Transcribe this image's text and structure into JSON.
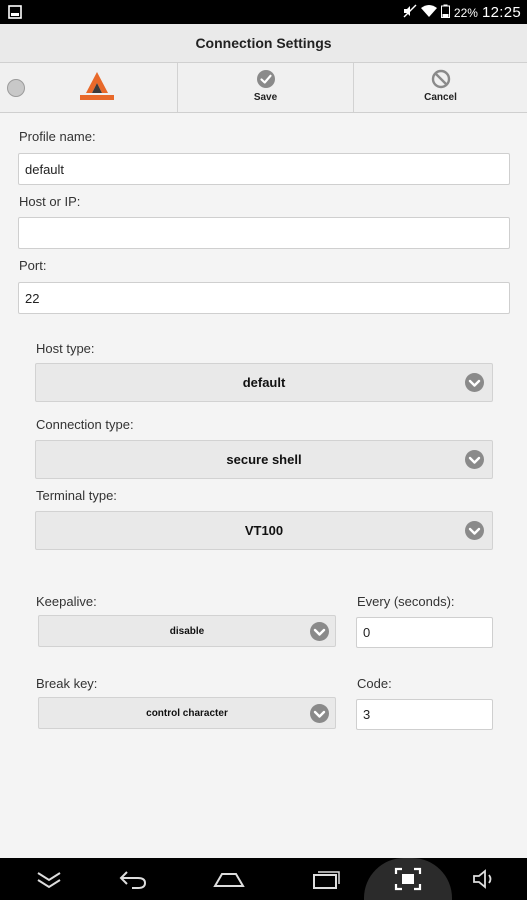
{
  "status_bar": {
    "battery": "22%",
    "time": "12:25"
  },
  "title": "Connection Settings",
  "toolbar": {
    "save_label": "Save",
    "cancel_label": "Cancel"
  },
  "form": {
    "profile_name": {
      "label": "Profile name:",
      "value": "default"
    },
    "host": {
      "label": "Host or IP:",
      "value": ""
    },
    "port": {
      "label": "Port:",
      "value": "22"
    },
    "host_type": {
      "label": "Host type:",
      "value": "default"
    },
    "connection_type": {
      "label": "Connection type:",
      "value": "secure shell"
    },
    "terminal_type": {
      "label": "Terminal type:",
      "value": "VT100"
    },
    "keepalive": {
      "label": "Keepalive:",
      "value": "disable"
    },
    "every": {
      "label": "Every (seconds):",
      "value": "0"
    },
    "break_key": {
      "label": "Break key:",
      "value": "control character"
    },
    "code": {
      "label": "Code:",
      "value": "3"
    }
  },
  "icons": {
    "save": "check-circle-icon",
    "cancel": "cancel-circle-icon",
    "dropdown": "chevron-down-icon",
    "nav_hide": "hide-keyboard-icon",
    "nav_back": "back-icon",
    "nav_home": "home-icon",
    "nav_recent": "recent-apps-icon",
    "nav_screenshot": "screenshot-icon",
    "nav_volume": "volume-icon"
  },
  "colors": {
    "logo_orange": "#e8692a",
    "logo_dark": "#3a3a3a",
    "background": "#f4f4f4"
  }
}
